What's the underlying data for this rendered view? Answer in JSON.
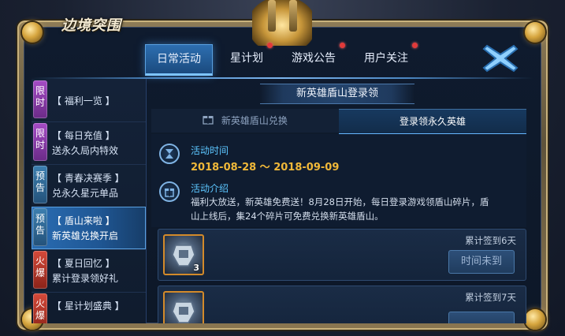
{
  "app": {
    "logo": "边境突围"
  },
  "topnav": {
    "tabs": [
      {
        "label": "日常活动",
        "active": true,
        "dot": false
      },
      {
        "label": "星计划",
        "active": false,
        "dot": true
      },
      {
        "label": "游戏公告",
        "active": false,
        "dot": true
      },
      {
        "label": "用户关注",
        "active": false,
        "dot": true
      }
    ]
  },
  "sidebar": {
    "items": [
      {
        "badge": "限时",
        "badge_type": "limit",
        "line1": "【 福利一览 】",
        "line2": ""
      },
      {
        "badge": "限时",
        "badge_type": "limit",
        "line1": "【 每日充值 】",
        "line2": "送永久局内特效"
      },
      {
        "badge": "预告",
        "badge_type": "preview",
        "line1": "【 青春决赛季 】",
        "line2": "兑永久星元单品"
      },
      {
        "badge": "预告",
        "badge_type": "preview",
        "line1": "【 盾山来啦 】",
        "line2": "新英雄兑换开启",
        "active": true
      },
      {
        "badge": "火爆",
        "badge_type": "hot",
        "line1": "【 夏日回忆 】",
        "line2": "累计登录领好礼"
      },
      {
        "badge": "火爆",
        "badge_type": "hot",
        "line1": "【 星计划盛典 】",
        "line2": ""
      }
    ]
  },
  "main": {
    "banner": "新英雄盾山登录领",
    "subtabs": [
      {
        "label": "新英雄盾山兑换",
        "active": false
      },
      {
        "label": "登录领永久英雄",
        "active": true
      }
    ],
    "time_heading": "活动时间",
    "time_range": "2018-08-28 ～ 2018-09-09",
    "intro_heading": "活动介绍",
    "intro_text": "福利大放送，新英雄免费送！8月28日开始，每日登录游戏领盾山碎片，盾山上线后，集24个碎片可免费兑换新英雄盾山。",
    "rewards": [
      {
        "count": "3",
        "label": "累计签到6天",
        "button": "时间未到"
      },
      {
        "count": "",
        "label": "累计签到7天",
        "button": ""
      }
    ]
  },
  "colors": {
    "accent_blue": "#5cc6ff",
    "date_gold": "#f0b839",
    "active_tab": "#2d6fb1",
    "notification_dot": "#e23a3a"
  }
}
